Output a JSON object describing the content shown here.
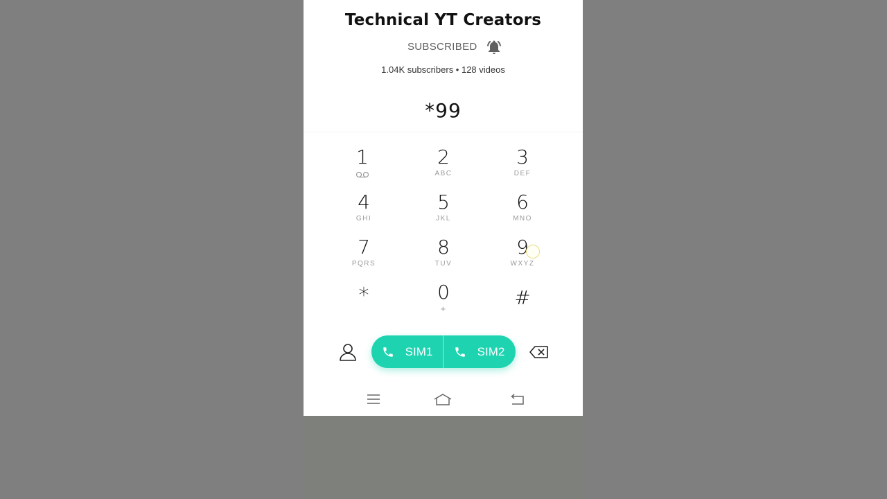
{
  "channel": {
    "title": "Technical YT Creators",
    "subscribe_label": "SUBSCRIBED",
    "stats": "1.04K subscribers • 128 videos"
  },
  "dialer": {
    "entered_number": "*99",
    "keys": [
      {
        "digit": "1",
        "letters": ""
      },
      {
        "digit": "2",
        "letters": "ABC"
      },
      {
        "digit": "3",
        "letters": "DEF"
      },
      {
        "digit": "4",
        "letters": "GHI"
      },
      {
        "digit": "5",
        "letters": "JKL"
      },
      {
        "digit": "6",
        "letters": "MNO"
      },
      {
        "digit": "7",
        "letters": "PQRS"
      },
      {
        "digit": "8",
        "letters": "TUV"
      },
      {
        "digit": "9",
        "letters": "WXYZ"
      },
      {
        "digit": "*",
        "letters": ""
      },
      {
        "digit": "0",
        "letters": "+"
      },
      {
        "digit": "#",
        "letters": ""
      }
    ],
    "sim1_label": "SIM1",
    "sim2_label": "SIM2"
  },
  "icons": {
    "bell": "bell-ringing-icon",
    "voicemail": "voicemail-icon",
    "contacts": "person-outline-icon",
    "backspace": "backspace-icon",
    "phone": "phone-handset-icon",
    "nav_menu": "hamburger-menu-icon",
    "nav_home": "home-icon",
    "nav_back": "back-icon"
  },
  "colors": {
    "accent": "#1dd3b0",
    "text_primary": "#111111",
    "text_secondary": "#606060"
  }
}
